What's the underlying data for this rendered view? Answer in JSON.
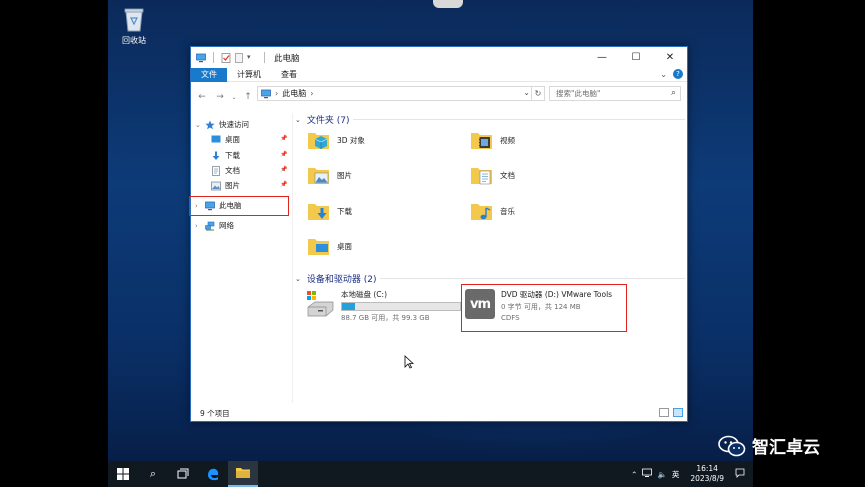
{
  "desktop": {
    "recycle_bin_label": "回收站"
  },
  "window": {
    "title": "此电脑",
    "controls": {
      "minimize": "—",
      "maximize": "☐",
      "close": "✕"
    },
    "ribbon_tabs": [
      "文件",
      "计算机",
      "查看"
    ],
    "address": {
      "path_root": "此电脑",
      "separator": "›"
    },
    "search_placeholder": "搜索\"此电脑\""
  },
  "nav": {
    "quick_access": "快速访问",
    "quick_items": [
      "桌面",
      "下载",
      "文档",
      "图片"
    ],
    "this_pc": "此电脑",
    "network": "网络"
  },
  "content": {
    "folders_header": "文件夹 (7)",
    "folders": [
      "3D 对象",
      "视频",
      "图片",
      "文档",
      "下载",
      "音乐",
      "桌面"
    ],
    "drives_header": "设备和驱动器 (2)",
    "drives": [
      {
        "name": "本地磁盘 (C:)",
        "detail": "88.7 GB 可用，共 99.3 GB",
        "used_fraction": 0.107
      },
      {
        "name": "DVD 驱动器 (D:) VMware Tools",
        "detail": "0 字节 可用，共 124 MB",
        "fs": "CDFS",
        "logo": "vm"
      }
    ]
  },
  "status": {
    "item_count": "9 个项目"
  },
  "taskbar": {
    "ime": "英",
    "time": "16:14",
    "date": "2023/8/9"
  },
  "watermark": {
    "text": "智汇卓云"
  },
  "colors": {
    "accent": "#1979ca",
    "highlight_box": "#e0231c",
    "group_header": "#1e3287",
    "capacity_fill": "#26a0da"
  }
}
